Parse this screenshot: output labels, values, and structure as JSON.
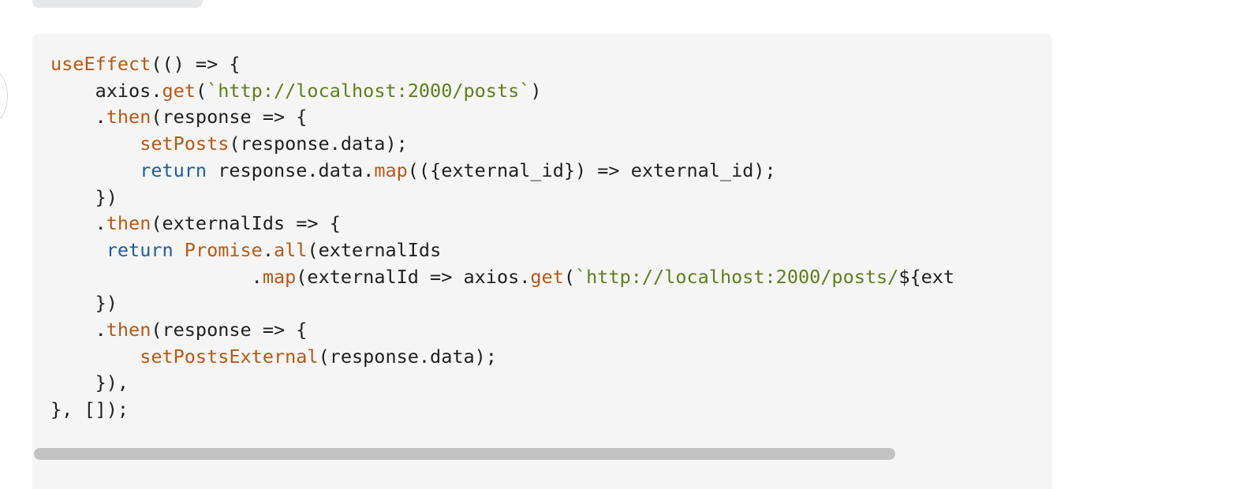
{
  "top_tab": {
    "label": ""
  },
  "code": {
    "lines": [
      [
        {
          "t": "useEffect",
          "c": "fn"
        },
        {
          "t": "(() => {",
          "c": "plain"
        }
      ],
      [
        {
          "t": "    axios.",
          "c": "plain"
        },
        {
          "t": "get",
          "c": "fn"
        },
        {
          "t": "(",
          "c": "plain"
        },
        {
          "t": "`http://localhost:2000/posts`",
          "c": "str"
        },
        {
          "t": ")",
          "c": "plain"
        }
      ],
      [
        {
          "t": "    .",
          "c": "plain"
        },
        {
          "t": "then",
          "c": "fn"
        },
        {
          "t": "(response => {",
          "c": "plain"
        }
      ],
      [
        {
          "t": "        ",
          "c": "plain"
        },
        {
          "t": "setPosts",
          "c": "fn"
        },
        {
          "t": "(response.data);",
          "c": "plain"
        }
      ],
      [
        {
          "t": "        ",
          "c": "plain"
        },
        {
          "t": "return",
          "c": "kw"
        },
        {
          "t": " response.data.",
          "c": "plain"
        },
        {
          "t": "map",
          "c": "fn"
        },
        {
          "t": "(({external_id}) => external_id);",
          "c": "plain"
        }
      ],
      [
        {
          "t": "    })",
          "c": "plain"
        }
      ],
      [
        {
          "t": "    .",
          "c": "plain"
        },
        {
          "t": "then",
          "c": "fn"
        },
        {
          "t": "(externalIds => {",
          "c": "plain"
        }
      ],
      [
        {
          "t": "     ",
          "c": "plain"
        },
        {
          "t": "return",
          "c": "kw"
        },
        {
          "t": " ",
          "c": "plain"
        },
        {
          "t": "Promise",
          "c": "fn"
        },
        {
          "t": ".",
          "c": "plain"
        },
        {
          "t": "all",
          "c": "fn"
        },
        {
          "t": "(externalIds",
          "c": "plain"
        }
      ],
      [
        {
          "t": "                  .",
          "c": "plain"
        },
        {
          "t": "map",
          "c": "fn"
        },
        {
          "t": "(externalId => axios.",
          "c": "plain"
        },
        {
          "t": "get",
          "c": "fn"
        },
        {
          "t": "(",
          "c": "plain"
        },
        {
          "t": "`http://localhost:2000/posts/",
          "c": "str"
        },
        {
          "t": "${ext",
          "c": "plain"
        }
      ],
      [
        {
          "t": "    })",
          "c": "plain"
        }
      ],
      [
        {
          "t": "    .",
          "c": "plain"
        },
        {
          "t": "then",
          "c": "fn"
        },
        {
          "t": "(response => {",
          "c": "plain"
        }
      ],
      [
        {
          "t": "        ",
          "c": "plain"
        },
        {
          "t": "setPostsExternal",
          "c": "fn"
        },
        {
          "t": "(response.data);",
          "c": "plain"
        }
      ],
      [
        {
          "t": "    }),",
          "c": "plain"
        }
      ],
      [
        {
          "t": "}, []);",
          "c": "plain"
        }
      ]
    ]
  },
  "scrollbar": {
    "position": 0.0
  },
  "colors": {
    "background": "#f5f5f5",
    "function": "#b75815",
    "keyword": "#215c99",
    "string": "#5e7e1c",
    "text": "#1f1f1f",
    "scrollbar_thumb": "#c2c2c2"
  }
}
